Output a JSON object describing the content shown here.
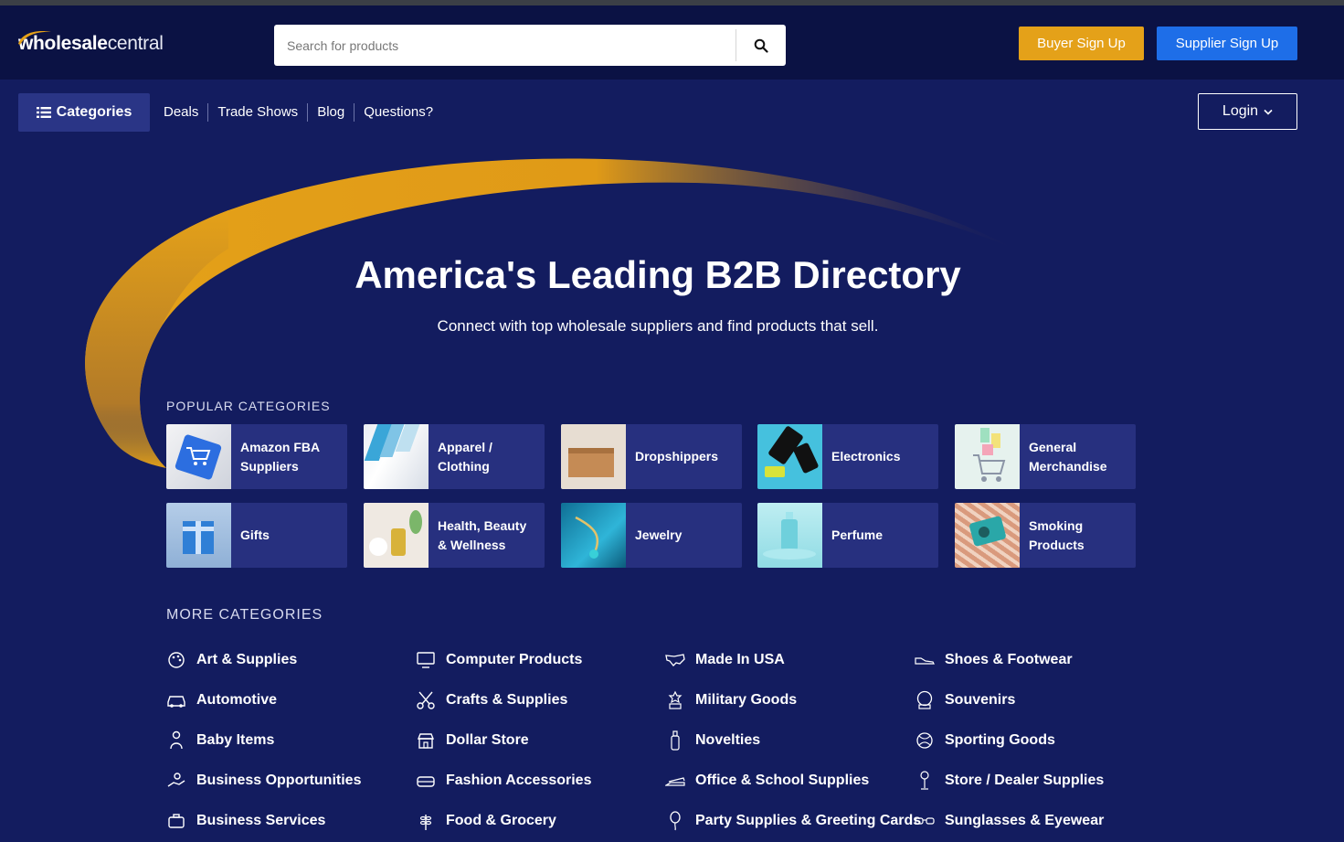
{
  "header": {
    "logo_bold": "wholesale",
    "logo_light": "central",
    "search_placeholder": "Search for products",
    "buyer_signup": "Buyer Sign Up",
    "supplier_signup": "Supplier Sign Up"
  },
  "nav": {
    "categories_label": "Categories",
    "links": [
      "Deals",
      "Trade Shows",
      "Blog",
      "Questions?"
    ],
    "login_label": "Login"
  },
  "hero": {
    "title": "America's Leading B2B Directory",
    "subtitle": "Connect with top wholesale suppliers and find products that sell."
  },
  "popular": {
    "title": "POPULAR CATEGORIES",
    "items": [
      {
        "label": "Amazon FBA Suppliers",
        "line1": "Amazon FBA",
        "line2": "Suppliers",
        "icon": "cart-keyboard-thumb"
      },
      {
        "label": "Apparel / Clothing",
        "line1": "Apparel /",
        "line2": "Clothing",
        "icon": "shirts-thumb"
      },
      {
        "label": "Dropshippers",
        "line1": "Dropshippers",
        "line2": "",
        "icon": "box-thumb"
      },
      {
        "label": "Electronics",
        "line1": "Electronics",
        "line2": "",
        "icon": "phones-thumb"
      },
      {
        "label": "General Merchandise",
        "line1": "General",
        "line2": "Merchandise",
        "icon": "shopping-cart-thumb"
      },
      {
        "label": "Gifts",
        "line1": "Gifts",
        "line2": "",
        "icon": "gift-box-thumb"
      },
      {
        "label": "Health, Beauty & Wellness",
        "line1": "Health, Beauty",
        "line2": "& Wellness",
        "icon": "spa-thumb"
      },
      {
        "label": "Jewelry",
        "line1": "Jewelry",
        "line2": "",
        "icon": "necklace-thumb"
      },
      {
        "label": "Perfume",
        "line1": "Perfume",
        "line2": "",
        "icon": "perfume-bottle-thumb"
      },
      {
        "label": "Smoking Products",
        "line1": "Smoking",
        "line2": "Products",
        "icon": "smoking-thumb"
      }
    ]
  },
  "more": {
    "title": "MORE CATEGORIES",
    "columns": [
      [
        {
          "label": "Art & Supplies",
          "icon": "palette-icon"
        },
        {
          "label": "Automotive",
          "icon": "car-icon"
        },
        {
          "label": "Baby Items",
          "icon": "baby-icon"
        },
        {
          "label": "Business Opportunities",
          "icon": "handshake-icon"
        },
        {
          "label": "Business Services",
          "icon": "briefcase-icon"
        }
      ],
      [
        {
          "label": "Computer Products",
          "icon": "monitor-icon"
        },
        {
          "label": "Crafts & Supplies",
          "icon": "scissors-icon"
        },
        {
          "label": "Dollar Store",
          "icon": "store-icon"
        },
        {
          "label": "Fashion Accessories",
          "icon": "bag-icon"
        },
        {
          "label": "Food & Grocery",
          "icon": "wheat-icon"
        }
      ],
      [
        {
          "label": "Made In USA",
          "icon": "usa-map-icon"
        },
        {
          "label": "Military Goods",
          "icon": "medal-icon"
        },
        {
          "label": "Novelties",
          "icon": "bottle-icon"
        },
        {
          "label": "Office & School Supplies",
          "icon": "stapler-icon"
        },
        {
          "label": "Party Supplies & Greeting Cards",
          "icon": "balloon-icon"
        }
      ],
      [
        {
          "label": "Shoes & Footwear",
          "icon": "shoe-icon"
        },
        {
          "label": "Souvenirs",
          "icon": "snowglobe-icon"
        },
        {
          "label": "Sporting Goods",
          "icon": "ball-icon"
        },
        {
          "label": "Store / Dealer Supplies",
          "icon": "mannequin-icon"
        },
        {
          "label": "Sunglasses & Eyewear",
          "icon": "glasses-icon"
        }
      ]
    ]
  },
  "colors": {
    "page_bg": "#131c5f",
    "header_bg": "#0b1244",
    "card_bg": "#27307f",
    "accent_orange": "#e4a119",
    "accent_blue": "#1e6ee8"
  }
}
